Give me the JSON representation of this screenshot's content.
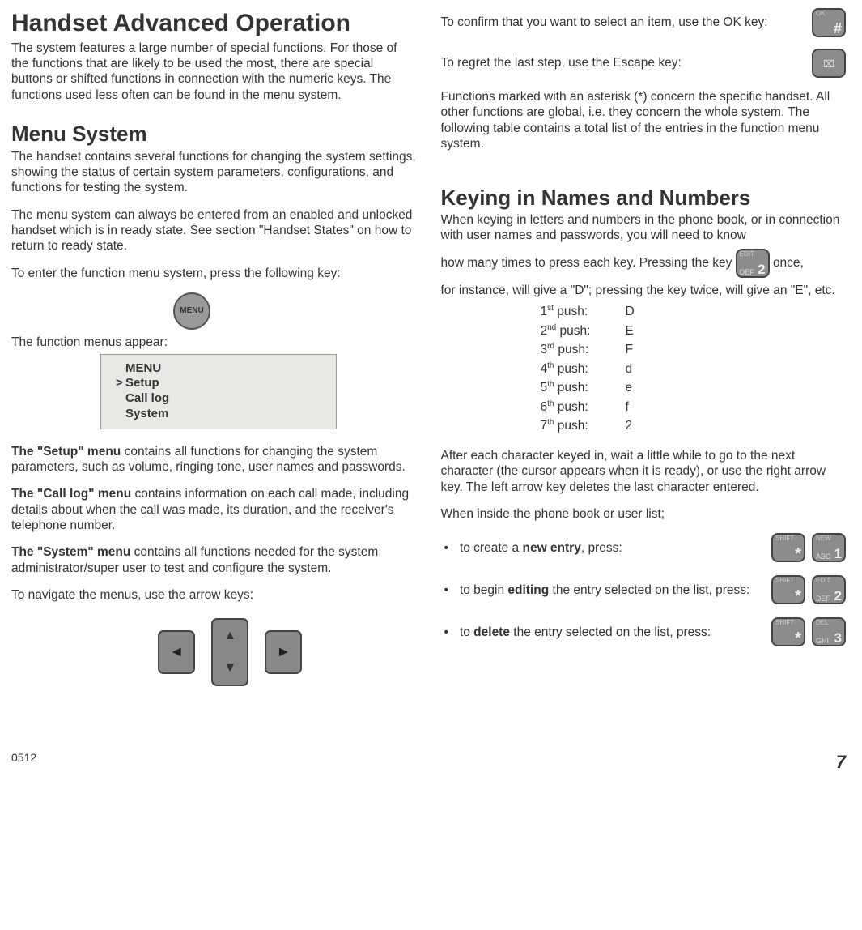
{
  "left": {
    "h1": "Handset Advanced Operation",
    "intro": "The system features a large number of special functions. For those of the functions that are likely to be used the most, there are special buttons or shifted functions in connection with the numeric keys. The functions used less often can be found in the menu system.",
    "h2": "Menu System",
    "p1": "The handset contains several functions for changing the system settings, showing the status of certain system parameters, configurations, and functions for testing the system.",
    "p2": "The menu system can always be entered from an enabled and unlocked handset which is in ready state. See section \"Handset States\" on how to return to ready state.",
    "p3": "To enter the function menu system, press the following key:",
    "menu_key": "MENU",
    "p4": "The function menus appear:",
    "lcd": {
      "title": "MENU",
      "items": [
        "Setup",
        "Call log",
        "System"
      ],
      "selected": 0
    },
    "setup_b": "The \"Setup\" menu",
    "setup_t": " contains all functions for changing the system parameters, such as volume, ringing tone, user names and passwords.",
    "call_b": "The \"Call log\" menu",
    "call_t": " contains information on each call made, including details about when the call was made, its duration, and the receiver's telephone number.",
    "sys_b": "The \"System\" menu",
    "sys_t": " contains all functions needed for the system administrator/super user to test and configure the system.",
    "p5": "To navigate the menus, use the arrow keys:"
  },
  "right": {
    "r1": "To confirm that you want to select an item, use the OK key:",
    "r2": "To regret the last step, use the Escape key:",
    "r3": "Functions marked with an asterisk (*) concern the specific handset. All other functions are global, i.e. they concern the whole system. The following table contains a total list of the entries in the function menu system.",
    "h2": "Keying in Names and Numbers",
    "k1a": "When keying in letters and numbers in the phone book, or in connection with user names and passwords, you will need to know",
    "k1b": "how many times to press each key. Pressing the key ",
    "k1c": " once,",
    "k1d": "for instance, will give a \"D\"; pressing the key twice, will give an \"E\", etc.",
    "pushes": [
      {
        "ord": "1",
        "suf": "st",
        "char": "D"
      },
      {
        "ord": "2",
        "suf": "nd",
        "char": "E"
      },
      {
        "ord": "3",
        "suf": "rd",
        "char": "F"
      },
      {
        "ord": "4",
        "suf": "th",
        "char": "d"
      },
      {
        "ord": "5",
        "suf": "th",
        "char": "e"
      },
      {
        "ord": "6",
        "suf": "th",
        "char": "f"
      },
      {
        "ord": "7",
        "suf": "th",
        "char": "2"
      }
    ],
    "k2": "After each character keyed in, wait a little while to go to the next character (the cursor appears when it is ready), or use the right arrow key. The left arrow key deletes the last character entered.",
    "k3": "When inside the phone book or user list;",
    "b1a": "to create a ",
    "b1b": "new entry",
    "b1c": ", press:",
    "b2a": "to begin ",
    "b2b": "editing",
    "b2c": " the entry selected on the list, press:",
    "b3a": "to ",
    "b3b": "delete",
    "b3c": " the entry selected on the list, press:"
  },
  "keys": {
    "ok_top": "OK",
    "hash": "#",
    "shift_top": "SHIFT",
    "star": "*",
    "k1_top": "NEW",
    "k1_bot": "ABC",
    "k1_num": "1",
    "k2_top": "EDIT",
    "k2_bot": "DEF",
    "k2_num": "2",
    "k3_top": "DEL",
    "k3_bot": "GHI",
    "k3_num": "3"
  },
  "footer": {
    "code": "0512",
    "page": "7"
  }
}
